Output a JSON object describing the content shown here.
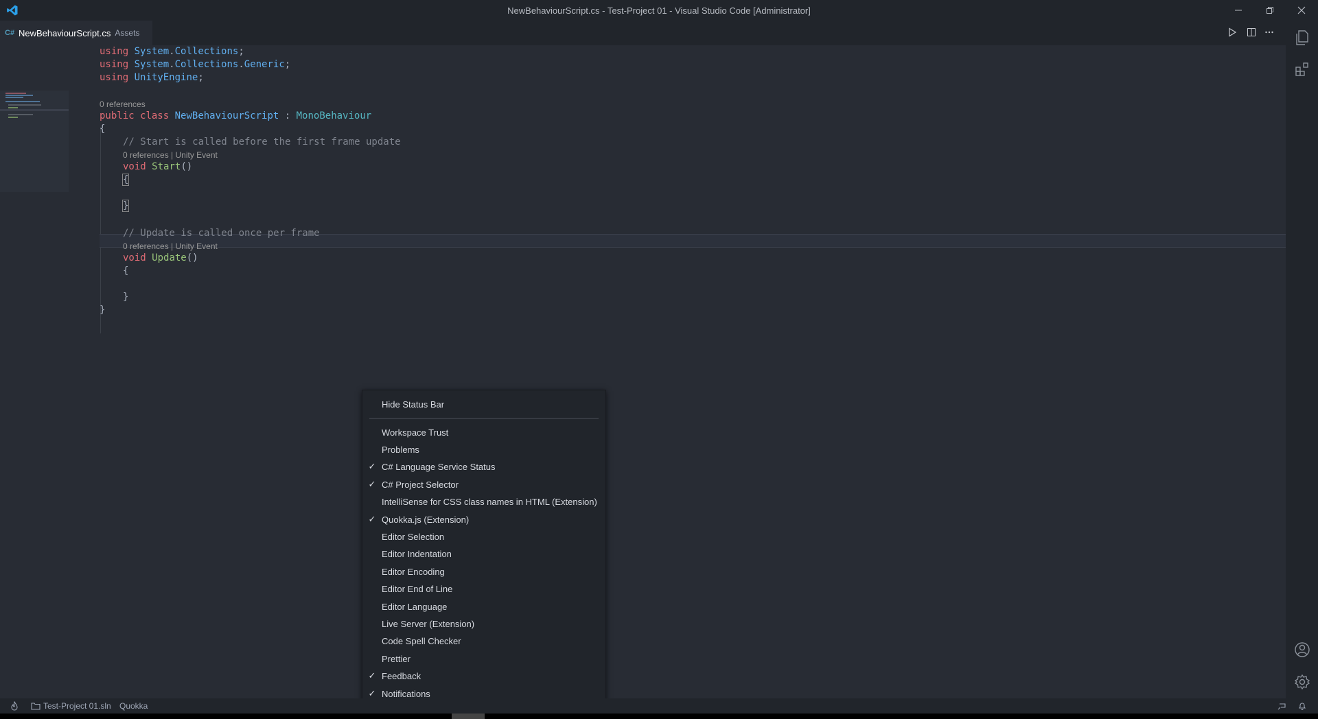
{
  "window": {
    "title": "NewBehaviourScript.cs - Test-Project 01 - Visual Studio Code [Administrator]"
  },
  "tab": {
    "icon_text": "C#",
    "name": "NewBehaviourScript.cs",
    "path": "Assets"
  },
  "code": {
    "lines": [
      {
        "kw": "using",
        "sp": " ",
        "ns1": "System",
        "dot": ".",
        "ns2": "Collections",
        "end": ";"
      },
      {
        "kw": "using",
        "sp": " ",
        "ns1": "System",
        "dot": ".",
        "ns2": "Collections",
        "dot2": ".",
        "ns3": "Generic",
        "end": ";"
      },
      {
        "kw": "using",
        "sp": " ",
        "ns1": "UnityEngine",
        "end": ";"
      }
    ],
    "class_lens": "0 references",
    "class_kw1": "public",
    "class_kw2": "class",
    "class_name": "NewBehaviourScript",
    "class_colon": " : ",
    "class_base": "MonoBehaviour",
    "open_brace": "{",
    "close_brace": "}",
    "start_comment": "// Start is called before the first frame update",
    "start_lens": "0 references | Unity Event",
    "void_kw": "void",
    "start_name": "Start",
    "parens": "()",
    "update_comment": "// Update is called once per frame",
    "update_lens": "0 references | Unity Event",
    "update_name": "Update"
  },
  "context_menu": {
    "items": [
      {
        "label": "Hide Status Bar",
        "checked": false
      },
      {
        "label": "Workspace Trust",
        "checked": false
      },
      {
        "label": "Problems",
        "checked": false
      },
      {
        "label": "C# Language Service Status",
        "checked": true
      },
      {
        "label": "C# Project Selector",
        "checked": true
      },
      {
        "label": "IntelliSense for CSS class names in HTML (Extension)",
        "checked": false
      },
      {
        "label": "Quokka.js (Extension)",
        "checked": true
      },
      {
        "label": "Editor Selection",
        "checked": false
      },
      {
        "label": "Editor Indentation",
        "checked": false
      },
      {
        "label": "Editor Encoding",
        "checked": false
      },
      {
        "label": "Editor End of Line",
        "checked": false
      },
      {
        "label": "Editor Language",
        "checked": false
      },
      {
        "label": "Live Server (Extension)",
        "checked": false
      },
      {
        "label": "Code Spell Checker",
        "checked": false
      },
      {
        "label": "Prettier",
        "checked": false
      },
      {
        "label": "Feedback",
        "checked": true
      },
      {
        "label": "Notifications",
        "checked": true
      }
    ],
    "check_glyph": "✓"
  },
  "statusbar": {
    "solution": "Test-Project 01.sln",
    "quokka": "Quokka"
  },
  "colors": {
    "background": "#282c34",
    "chrome": "#21252b",
    "keyword": "#e06c75",
    "type": "#61afef",
    "function": "#98c379",
    "comment": "#7f848e"
  }
}
